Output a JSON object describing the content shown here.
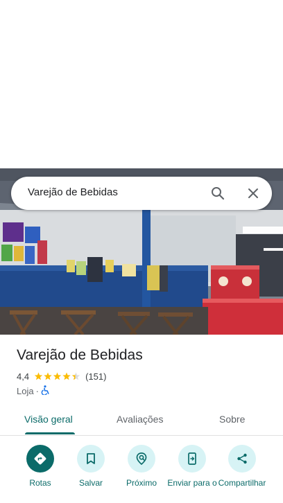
{
  "search": {
    "query": "Varejão de Bebidas"
  },
  "place": {
    "name": "Varejão de Bebidas",
    "rating": "4,4",
    "rating_value": 4.4,
    "review_count": "(151)",
    "category": "Loja",
    "separator": "·"
  },
  "tabs": [
    {
      "label": "Visão geral",
      "active": true
    },
    {
      "label": "Avaliações",
      "active": false
    },
    {
      "label": "Sobre",
      "active": false
    }
  ],
  "actions": [
    {
      "label": "Rotas",
      "icon": "directions-icon"
    },
    {
      "label": "Salvar",
      "icon": "bookmark-icon"
    },
    {
      "label": "Próximo",
      "icon": "nearby-icon"
    },
    {
      "label": "Enviar para o",
      "icon": "send-to-phone-icon"
    },
    {
      "label": "Compartilhar",
      "icon": "share-icon"
    }
  ],
  "colors": {
    "accent": "#0b6b69",
    "action_bg": "#d7f3f5",
    "star": "#fbbc04"
  }
}
